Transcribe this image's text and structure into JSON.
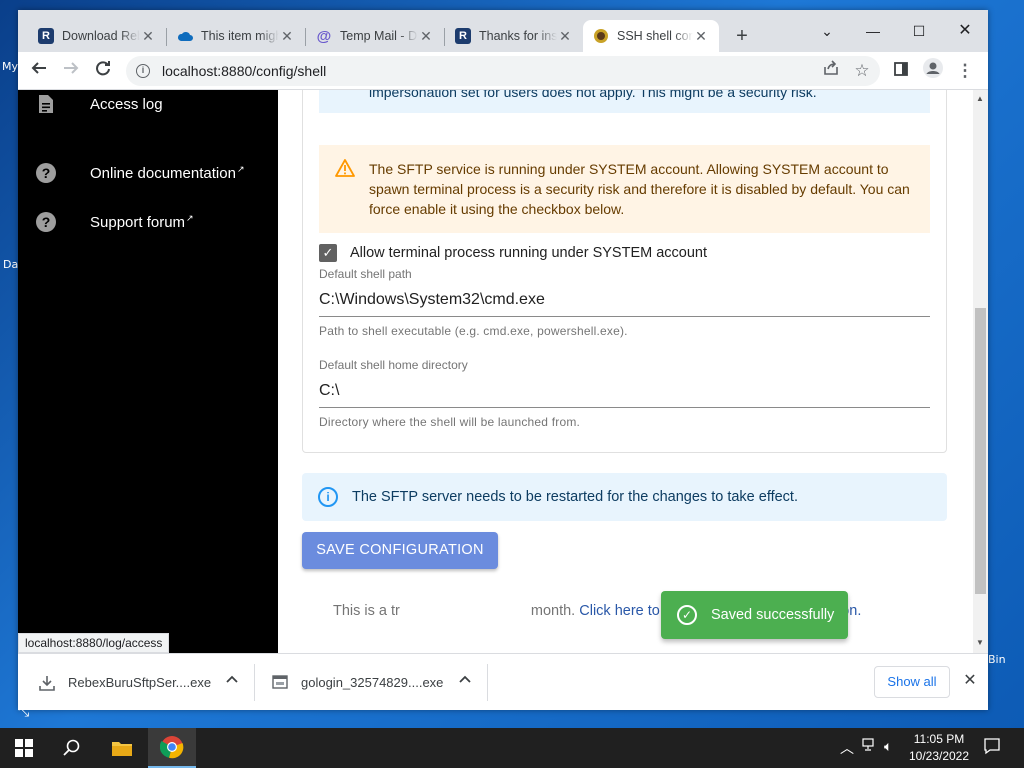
{
  "desktop": {
    "fragments": [
      "My",
      "Da",
      "Bin"
    ]
  },
  "browser": {
    "tabs": [
      {
        "title": "Download Rebex",
        "favicon": "rebex-icon",
        "active": false
      },
      {
        "title": "This item might",
        "favicon": "onedrive-icon",
        "active": false
      },
      {
        "title": "Temp Mail - D",
        "favicon": "tempmail-icon",
        "active": false
      },
      {
        "title": "Thanks for ins",
        "favicon": "rebex-icon",
        "active": false
      },
      {
        "title": "SSH shell con",
        "favicon": "rebex-shield-icon",
        "active": true
      }
    ],
    "new_tab": "+",
    "url": "localhost:8880/config/shell",
    "status_hint": "localhost:8880/log/access"
  },
  "sidebar": {
    "items": [
      {
        "label": "Access log",
        "icon": "document-icon",
        "external": false
      },
      {
        "label": "Online documentation",
        "icon": "help-icon",
        "external": true
      },
      {
        "label": "Support forum",
        "icon": "help-icon",
        "external": true
      }
    ]
  },
  "main": {
    "prev_alert_text": "impersonation set for users does not apply. This might be a security risk.",
    "warning_text": "The SFTP service is running under SYSTEM account. Allowing SYSTEM account to spawn terminal process is a security risk and therefore it is disabled by default. You can force enable it using the checkbox below.",
    "checkbox_label": "Allow terminal process running under SYSTEM account",
    "checkbox_checked": true,
    "shell_path": {
      "label": "Default shell path",
      "value": "C:\\Windows\\System32\\cmd.exe",
      "help": "Path to shell executable (e.g. cmd.exe, powershell.exe)."
    },
    "home_dir": {
      "label": "Default shell home directory",
      "value": "C:\\",
      "help": "Directory where the shell will be launched from."
    },
    "info_text": "The SFTP server needs to be restarted for the changes to take effect.",
    "save_label": "SAVE CONFIGURATION",
    "trial_prefix": "This is a tr",
    "trial_middle": "month.",
    "trial_link": "Click here to upgrade to Pro or Free edition."
  },
  "toast": {
    "text": "Saved successfully"
  },
  "downloads": {
    "items": [
      {
        "name": "RebexBuruSftpSer....exe",
        "icon": "download-icon"
      },
      {
        "name": "gologin_32574829....exe",
        "icon": "installer-icon"
      }
    ],
    "show_all": "Show all"
  },
  "taskbar": {
    "time": "11:05 PM",
    "date": "10/23/2022"
  },
  "colors": {
    "sidebar_bg": "#000000",
    "warning_bg": "#fff4e5",
    "info_bg": "#e8f4fd",
    "save_button": "#6b8cde",
    "toast_bg": "#4caf50",
    "link": "#2a58a8"
  }
}
